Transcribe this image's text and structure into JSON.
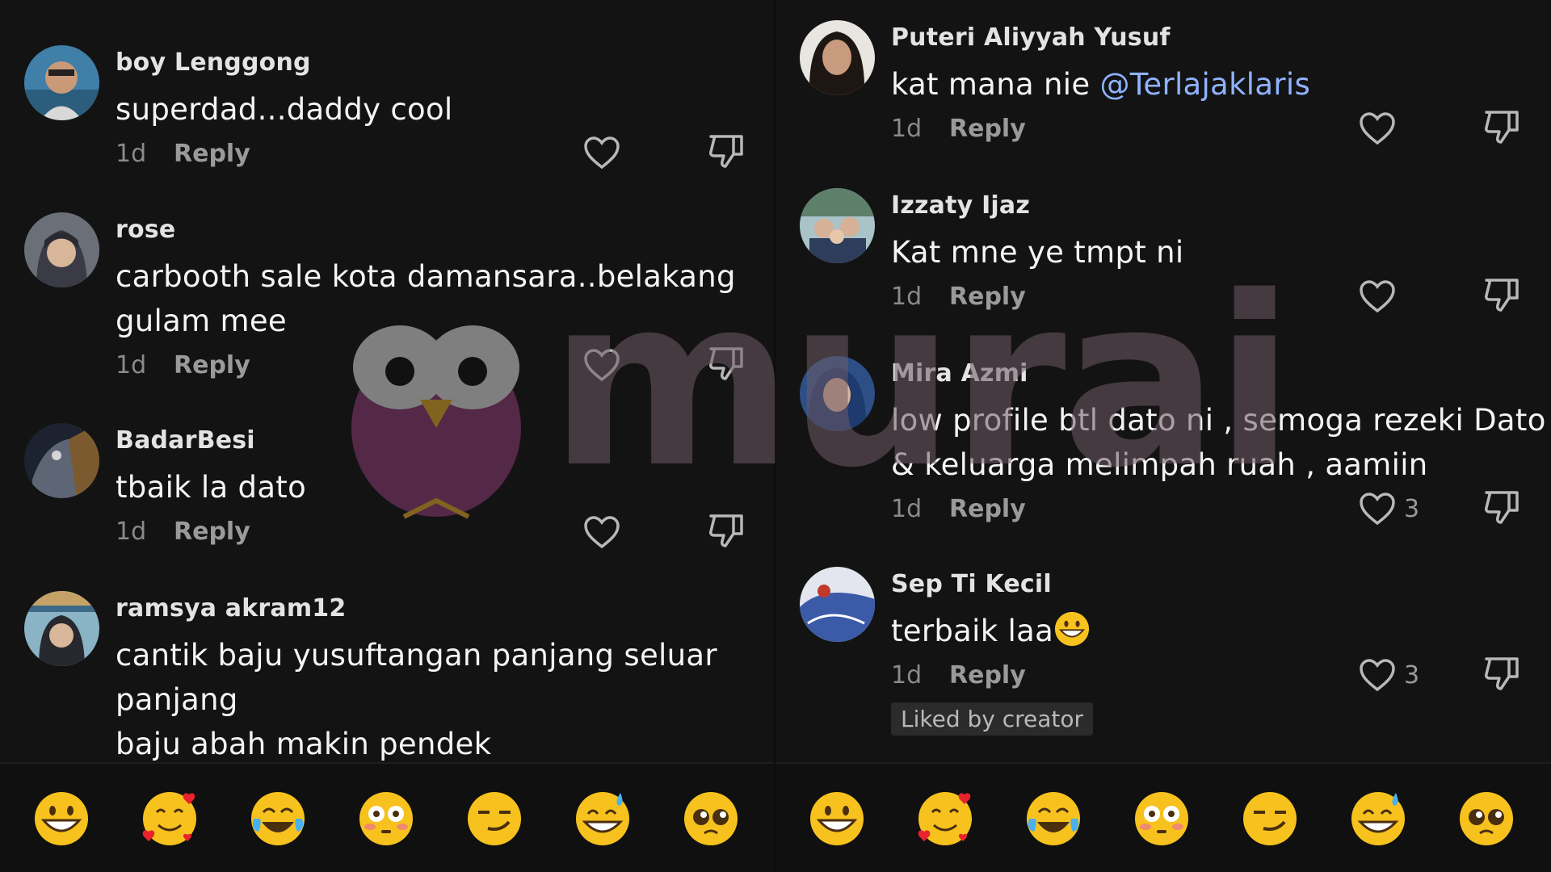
{
  "left_panel": {
    "comments": [
      {
        "username": "boy Lenggong",
        "lines": [
          "superdad...daddy cool"
        ],
        "age": "1d",
        "reply": "Reply"
      },
      {
        "username": "rose",
        "lines": [
          "carbooth sale kota damansara..belakang",
          "gulam mee"
        ],
        "age": "1d",
        "reply": "Reply"
      },
      {
        "username": "BadarBesi",
        "lines": [
          "tbaik la dato"
        ],
        "age": "1d",
        "reply": "Reply"
      },
      {
        "username": "ramsya akram12",
        "lines": [
          "cantik baju yusuftangan panjang seluar",
          "panjang",
          "baju abah makin pendek"
        ]
      }
    ]
  },
  "right_panel": {
    "comments": [
      {
        "username": "Puteri Aliyyah Yusuf",
        "text_before": "kat mana nie ",
        "mention": "@Terlajaklaris",
        "age": "1d",
        "reply": "Reply"
      },
      {
        "username": "Izzaty Ijaz",
        "lines": [
          "Kat mne ye tmpt ni"
        ],
        "age": "1d",
        "reply": "Reply"
      },
      {
        "username": "Mira Azmi",
        "lines": [
          "low profile btl dato ni , semoga rezeki Dato",
          "& keluarga melimpah ruah , aamiin"
        ],
        "age": "1d",
        "reply": "Reply",
        "like_count": "3"
      },
      {
        "username": "Sep Ti Kecil",
        "text": "terbaik laa",
        "text_emoji": "grinning-face",
        "age": "1d",
        "reply": "Reply",
        "like_count": "3",
        "badge": "Liked by creator"
      }
    ]
  },
  "emoji_bar": [
    "grinning-face",
    "smiling-face-with-hearts",
    "tears-of-joy",
    "flushed-face",
    "smirking-face",
    "grinning-sweat",
    "pleading-face"
  ],
  "watermark": {
    "text": "murai"
  },
  "colors": {
    "background": "#131313",
    "mention": "#8fb3ff",
    "muted": "#8a8a8a",
    "badge_bg": "#2b2b2b"
  }
}
